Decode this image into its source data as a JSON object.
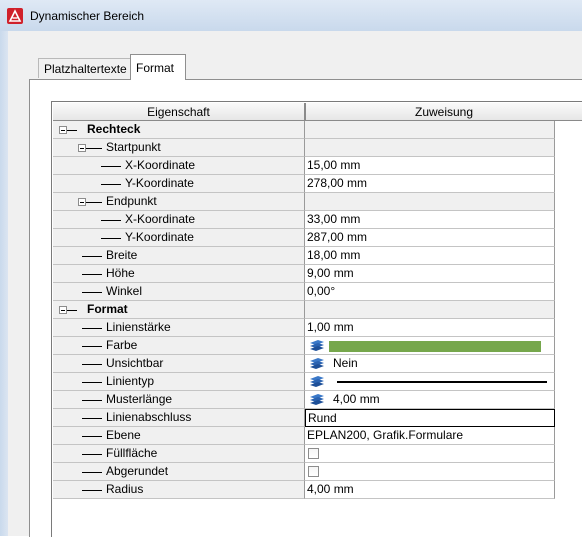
{
  "window": {
    "title": "Dynamischer Bereich"
  },
  "tabs": [
    {
      "label": "Platzhaltertexte",
      "active": false
    },
    {
      "label": "Format",
      "active": true
    }
  ],
  "grid": {
    "header": {
      "property": "Eigenschaft",
      "value": "Zuweisung"
    },
    "rows": [
      {
        "label": "Rechteck",
        "value": ""
      },
      {
        "label": "Startpunkt",
        "value": ""
      },
      {
        "label": "X-Koordinate",
        "value": "15,00 mm"
      },
      {
        "label": "Y-Koordinate",
        "value": "278,00 mm"
      },
      {
        "label": "Endpunkt",
        "value": ""
      },
      {
        "label": "X-Koordinate",
        "value": "33,00 mm"
      },
      {
        "label": "Y-Koordinate",
        "value": "287,00 mm"
      },
      {
        "label": "Breite",
        "value": "18,00 mm"
      },
      {
        "label": "Höhe",
        "value": "9,00 mm"
      },
      {
        "label": "Winkel",
        "value": "0,00°"
      },
      {
        "label": "Format",
        "value": ""
      },
      {
        "label": "Linienstärke",
        "value": "1,00 mm"
      },
      {
        "label": "Farbe",
        "value": "",
        "color": "#76a74c",
        "icon": "layers-icon"
      },
      {
        "label": "Unsichtbar",
        "value": "Nein",
        "icon": "layers-icon"
      },
      {
        "label": "Linientyp",
        "value": "",
        "icon": "layers-icon"
      },
      {
        "label": "Musterlänge",
        "value": "4,00 mm",
        "icon": "layers-icon"
      },
      {
        "label": "Linienabschluss",
        "value": "Rund"
      },
      {
        "label": "Ebene",
        "value": "EPLAN200, Grafik.Formulare"
      },
      {
        "label": "Füllfläche",
        "value": "",
        "checked": false
      },
      {
        "label": "Abgerundet",
        "value": "",
        "checked": false
      },
      {
        "label": "Radius",
        "value": "4,00 mm"
      }
    ]
  }
}
